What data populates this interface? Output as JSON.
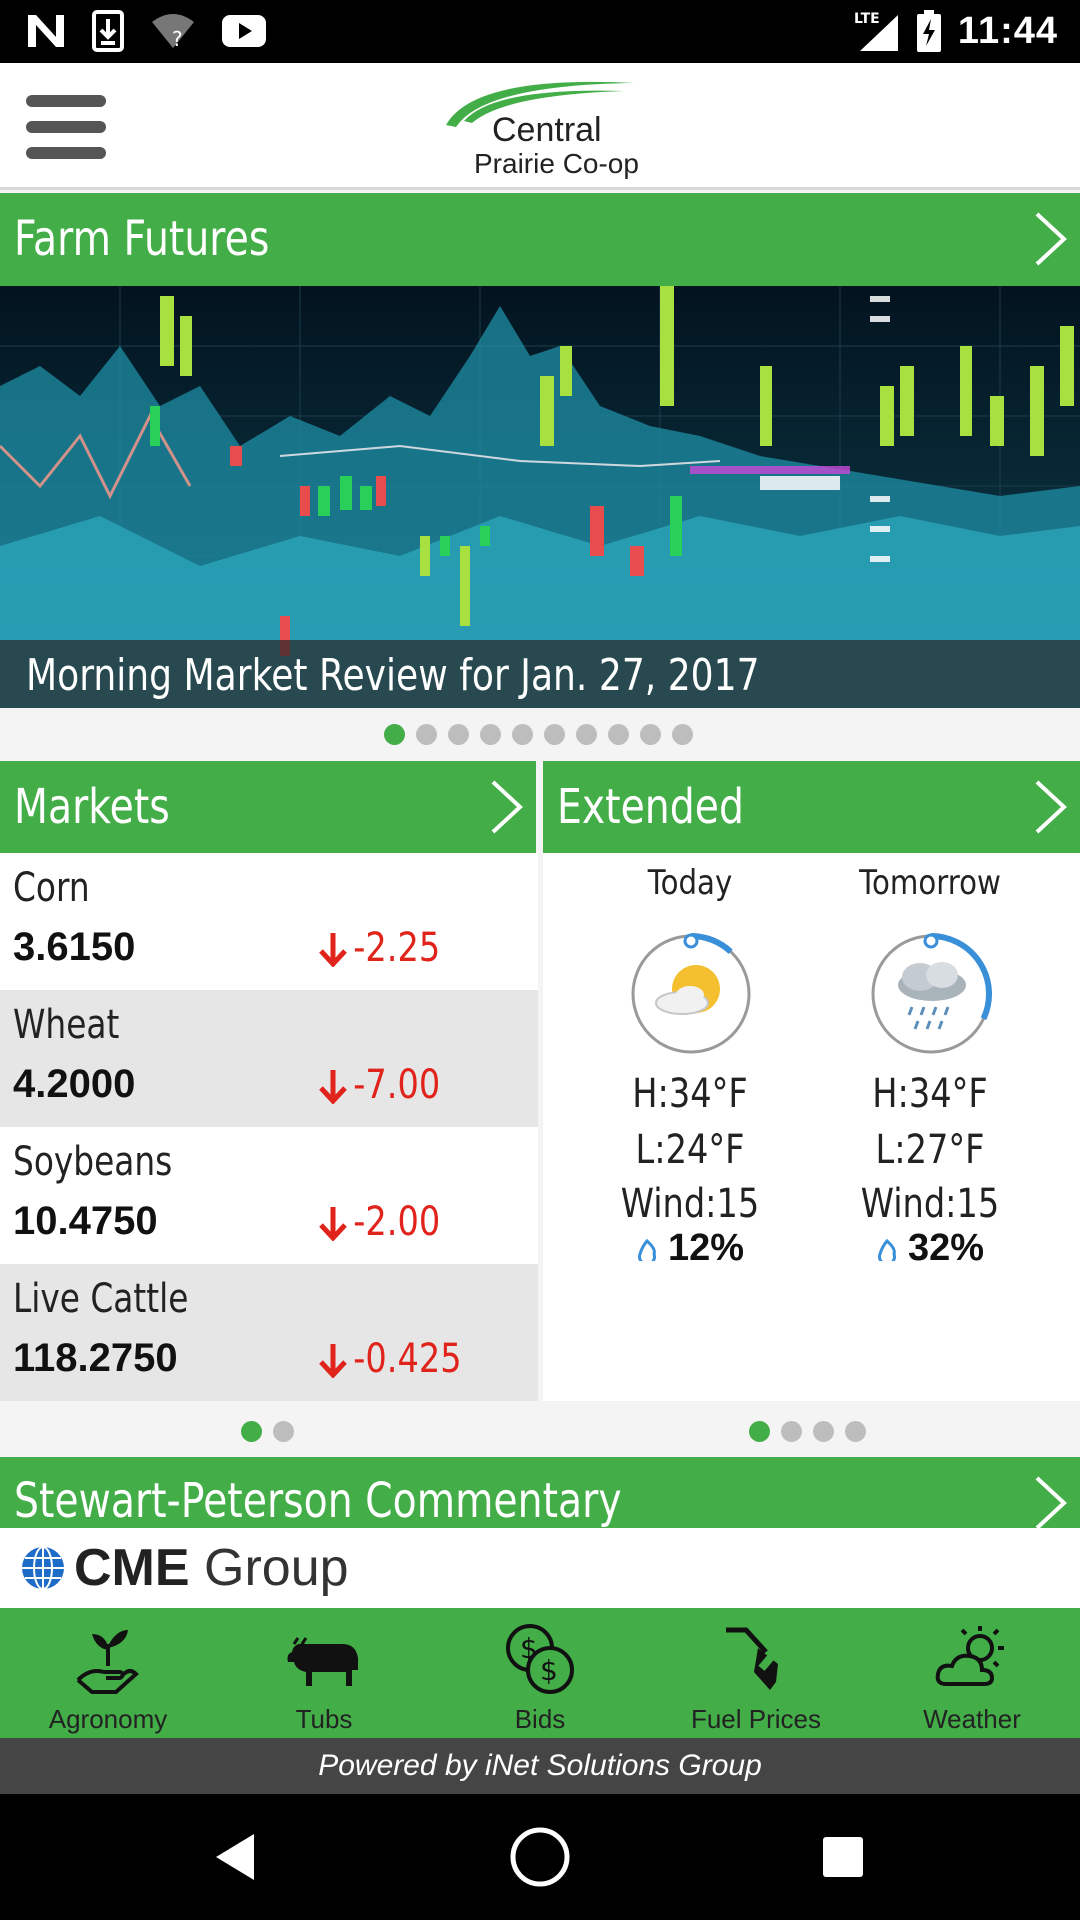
{
  "status_bar": {
    "time": "11:44",
    "network": "LTE",
    "icons": [
      "n-icon",
      "download-icon",
      "wifi-icon",
      "youtube-icon",
      "signal-icon",
      "battery-icon"
    ]
  },
  "header": {
    "logo_line1": "Central",
    "logo_line2": "Prairie Co-op"
  },
  "farm_futures": {
    "title": "Farm Futures",
    "caption": "Morning Market Review for Jan. 27, 2017",
    "slide_count": 10,
    "active_slide": 1
  },
  "markets": {
    "title": "Markets",
    "items": [
      {
        "name": "Corn",
        "price": "3.6150",
        "change": "-2.25"
      },
      {
        "name": "Wheat",
        "price": "4.2000",
        "change": "-7.00"
      },
      {
        "name": "Soybeans",
        "price": "10.4750",
        "change": "-2.00"
      },
      {
        "name": "Live Cattle",
        "price": "118.2750",
        "change": "-0.425"
      }
    ],
    "page_count": 2,
    "active_page": 1
  },
  "extended": {
    "title": "Extended",
    "days": [
      {
        "label": "Today",
        "high": "H:34°F",
        "low": "L:24°F",
        "wind": "Wind:15",
        "precip": "12%",
        "precip_fraction": 0.12,
        "icon": "partly-sunny-icon"
      },
      {
        "label": "Tomorrow",
        "high": "H:34°F",
        "low": "L:27°F",
        "wind": "Wind:15",
        "precip": "32%",
        "precip_fraction": 0.32,
        "icon": "rain-cloud-icon"
      }
    ],
    "page_count": 4,
    "active_page": 1
  },
  "commentary": {
    "title": "Stewart-Peterson Commentary",
    "sponsor_bold": "CME",
    "sponsor_rest": " Group"
  },
  "bottom_nav": [
    {
      "label": "Agronomy",
      "icon": "plant-hand-icon"
    },
    {
      "label": "Tubs",
      "icon": "cow-icon"
    },
    {
      "label": "Bids",
      "icon": "coins-icon"
    },
    {
      "label": "Fuel Prices",
      "icon": "fuel-nozzle-icon"
    },
    {
      "label": "Weather",
      "icon": "sun-cloud-icon"
    }
  ],
  "footer": {
    "powered_by": "Powered by iNet Solutions Group"
  },
  "colors": {
    "brand_green": "#43ad48",
    "down_red": "#e0231b",
    "precip_blue": "#3a8fd9"
  }
}
